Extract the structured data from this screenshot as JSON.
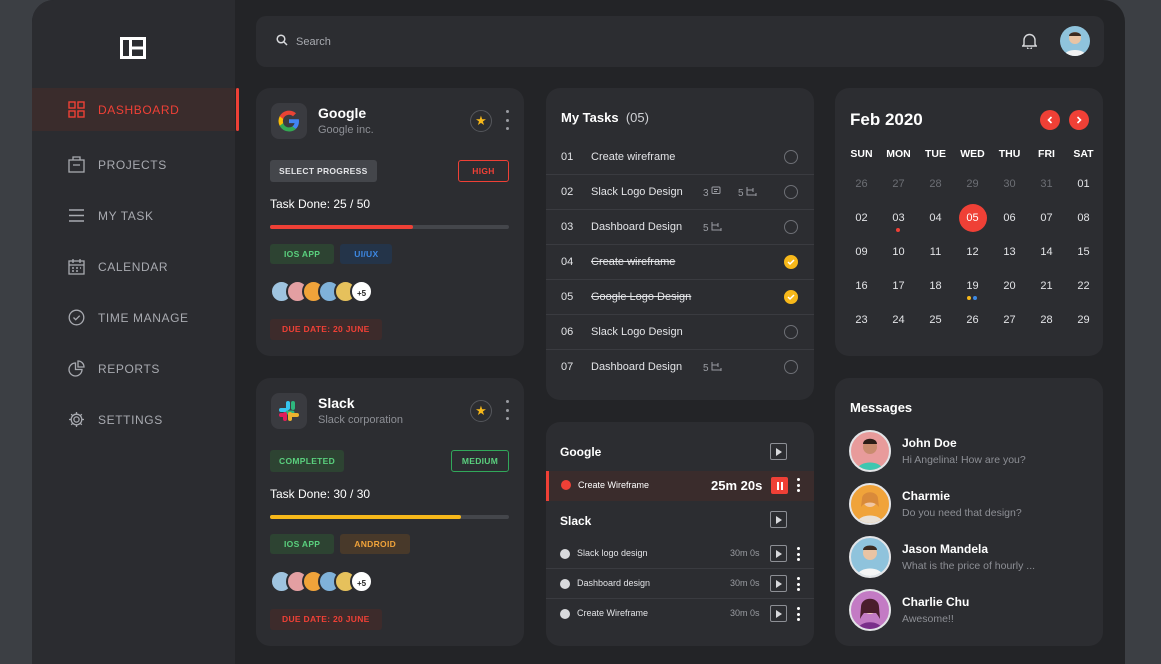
{
  "colors": {
    "accent": "#ef4036",
    "yellow": "#f7b81a",
    "green": "#5ad07e",
    "blue": "#3d88e3",
    "orange": "#f0a33a"
  },
  "sidebar": {
    "items": [
      {
        "label": "DASHBOARD",
        "icon": "grid-icon",
        "active": true
      },
      {
        "label": "PROJECTS",
        "icon": "briefcase-icon"
      },
      {
        "label": "MY TASK",
        "icon": "list-icon"
      },
      {
        "label": "CALENDAR",
        "icon": "calendar-icon"
      },
      {
        "label": "TIME MANAGE",
        "icon": "clock-icon"
      },
      {
        "label": "REPORTS",
        "icon": "pie-chart-icon"
      },
      {
        "label": "SETTINGS",
        "icon": "gear-icon"
      }
    ]
  },
  "topbar": {
    "search_placeholder": "Search"
  },
  "projects": [
    {
      "name": "Google",
      "company": "Google inc.",
      "progress_label": "SELECT PROGRESS",
      "priority": "HIGH",
      "task_done": "Task Done: 25 / 50",
      "progress": 0.6,
      "tags": [
        "IOS APP",
        "UI/UX"
      ],
      "more": "+5",
      "due": "DUE DATE: 20 JUNE"
    },
    {
      "name": "Slack",
      "company": "Slack corporation",
      "progress_label": "COMPLETED",
      "priority": "MEDIUM",
      "task_done": "Task Done: 30 / 30",
      "progress": 0.8,
      "tags": [
        "IOS APP",
        "ANDROID"
      ],
      "more": "+5",
      "due": "DUE DATE: 20 JUNE"
    }
  ],
  "tasks": {
    "title": "My Tasks",
    "count": "(05)",
    "items": [
      {
        "num": "01",
        "text": "Create wireframe",
        "done": false
      },
      {
        "num": "02",
        "text": "Slack Logo Design",
        "comments": "3",
        "subtasks": "5",
        "done": false
      },
      {
        "num": "03",
        "text": "Dashboard Design",
        "subtasks": "5",
        "done": false
      },
      {
        "num": "04",
        "text": "Create wireframe",
        "done": true
      },
      {
        "num": "05",
        "text": "Google Logo Design",
        "done": true
      },
      {
        "num": "06",
        "text": "Slack Logo Design",
        "done": false
      },
      {
        "num": "07",
        "text": "Dashboard Design",
        "subtasks": "5",
        "done": false
      }
    ]
  },
  "timer": {
    "google_label": "Google",
    "active_task": "Create Wireframe",
    "active_time": "25m 20s",
    "slack_label": "Slack",
    "slack_items": [
      {
        "name": "Slack logo design",
        "time": "30m 0s"
      },
      {
        "name": "Dashboard design",
        "time": "30m 0s"
      },
      {
        "name": "Create Wireframe",
        "time": "30m 0s"
      }
    ]
  },
  "calendar": {
    "title": "Feb 2020",
    "weekdays": [
      "SUN",
      "MON",
      "TUE",
      "WED",
      "THU",
      "FRI",
      "SAT"
    ],
    "days": [
      [
        "26",
        "27",
        "28",
        "29",
        "30",
        "31",
        "01"
      ],
      [
        "02",
        "03",
        "04",
        "05",
        "06",
        "07",
        "08"
      ],
      [
        "09",
        "10",
        "11",
        "12",
        "13",
        "14",
        "15"
      ],
      [
        "16",
        "17",
        "18",
        "19",
        "20",
        "21",
        "22"
      ],
      [
        "23",
        "24",
        "25",
        "26",
        "27",
        "28",
        "29"
      ]
    ],
    "today": "05"
  },
  "messages": {
    "title": "Messages",
    "items": [
      {
        "name": "John Doe",
        "text": "Hi Angelina! How are you?"
      },
      {
        "name": "Charmie",
        "text": "Do you need that design?"
      },
      {
        "name": "Jason Mandela",
        "text": "What is the price of hourly ..."
      },
      {
        "name": "Charlie Chu",
        "text": "Awesome!!"
      }
    ]
  }
}
